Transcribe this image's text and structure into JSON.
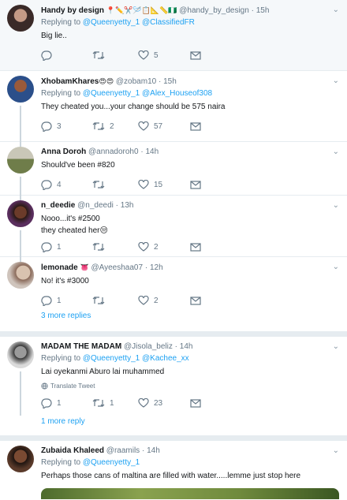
{
  "tweets": [
    {
      "name": "Handy by design",
      "emojis": "📍✏️✂️🪡📋📐📏🇳🇬",
      "handle": "@handy_by_design",
      "time": "15h",
      "reply_prefix": "Replying to",
      "mentions": [
        "@Queenyetty_1",
        "@ClassifiedFR"
      ],
      "text": "Big lie..",
      "replies": "",
      "retweets": "",
      "likes": "5"
    },
    {
      "name": "XhobamKhares",
      "emojis": "😍😍",
      "handle": "@zobam10",
      "time": "15h",
      "reply_prefix": "Replying to",
      "mentions": [
        "@Queenyetty_1",
        "@Alex_Houseof308"
      ],
      "text": "They cheated you...your change should be 575 naira",
      "replies": "3",
      "retweets": "2",
      "likes": "57"
    },
    {
      "name": "Anna Doroh",
      "emojis": "",
      "handle": "@annadoroh0",
      "time": "14h",
      "text": "Should've been #820",
      "replies": "4",
      "retweets": "",
      "likes": "15"
    },
    {
      "name": "n_deedie",
      "emojis": "",
      "handle": "@n_deedi",
      "time": "13h",
      "text": "Nooo...it's #2500",
      "text2": "they cheated her😒",
      "replies": "1",
      "retweets": "",
      "likes": "2"
    },
    {
      "name": "lemonade",
      "emojis": "👅",
      "handle": "@Ayeeshaa07",
      "time": "12h",
      "text": "No! it's #3000",
      "replies": "1",
      "retweets": "",
      "likes": "2"
    },
    {
      "name": "MADAM THE MADAM",
      "emojis": "",
      "handle": "@Jisola_beliz",
      "time": "14h",
      "reply_prefix": "Replying to",
      "mentions": [
        "@Queenyetty_1",
        "@Kachee_xx"
      ],
      "text": "Lai oyekanmi Aburo lai muhammed",
      "translate": "Translate Tweet",
      "replies": "1",
      "retweets": "1",
      "likes": "23"
    },
    {
      "name": "Zubaida Khaleed",
      "emojis": "",
      "handle": "@raamils",
      "time": "14h",
      "reply_prefix": "Replying to",
      "mentions": [
        "@Queenyetty_1"
      ],
      "text": "Perhaps those cans of maltina are filled with water.....lemme just stop here"
    }
  ],
  "more_replies_1": "3 more replies",
  "more_replies_2": "1 more reply",
  "dot": "·",
  "colors": {
    "link": "#1da1f2",
    "muted": "#657786",
    "divider": "#e6ecf0"
  }
}
